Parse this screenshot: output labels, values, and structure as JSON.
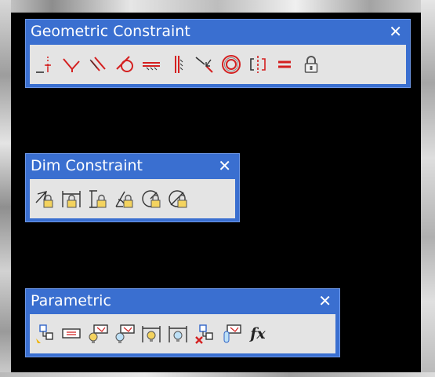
{
  "toolbars": {
    "geometric": {
      "title": "Geometric Constraint",
      "close": "✕",
      "tools": [
        "coincident-icon",
        "perpendicular-icon",
        "parallel-icon",
        "tangent-icon",
        "horizontal-icon",
        "vertical-icon",
        "collinear-icon",
        "concentric-icon",
        "symmetric-icon",
        "equal-icon",
        "fix-icon"
      ]
    },
    "dim": {
      "title": "Dim Constraint",
      "close": "✕",
      "tools": [
        "aligned-dim-lock-icon",
        "horizontal-dim-lock-icon",
        "vertical-dim-lock-icon",
        "angular-dim-lock-icon",
        "radial-dim-lock-icon",
        "diameter-dim-lock-icon"
      ]
    },
    "parametric": {
      "title": "Parametric",
      "close": "✕",
      "fx_label": "fx",
      "tools": [
        "auto-constrain-icon",
        "show-dyn-icon",
        "show-all-icon",
        "hide-all-icon",
        "show-dims-icon",
        "hide-dims-icon",
        "delete-constraints-icon",
        "param-manager-icon",
        "fx-icon"
      ]
    }
  },
  "colors": {
    "titlebar": "#3a6fd0",
    "toolbar_bg": "#e4e4e4",
    "icon_red": "#d42020"
  }
}
